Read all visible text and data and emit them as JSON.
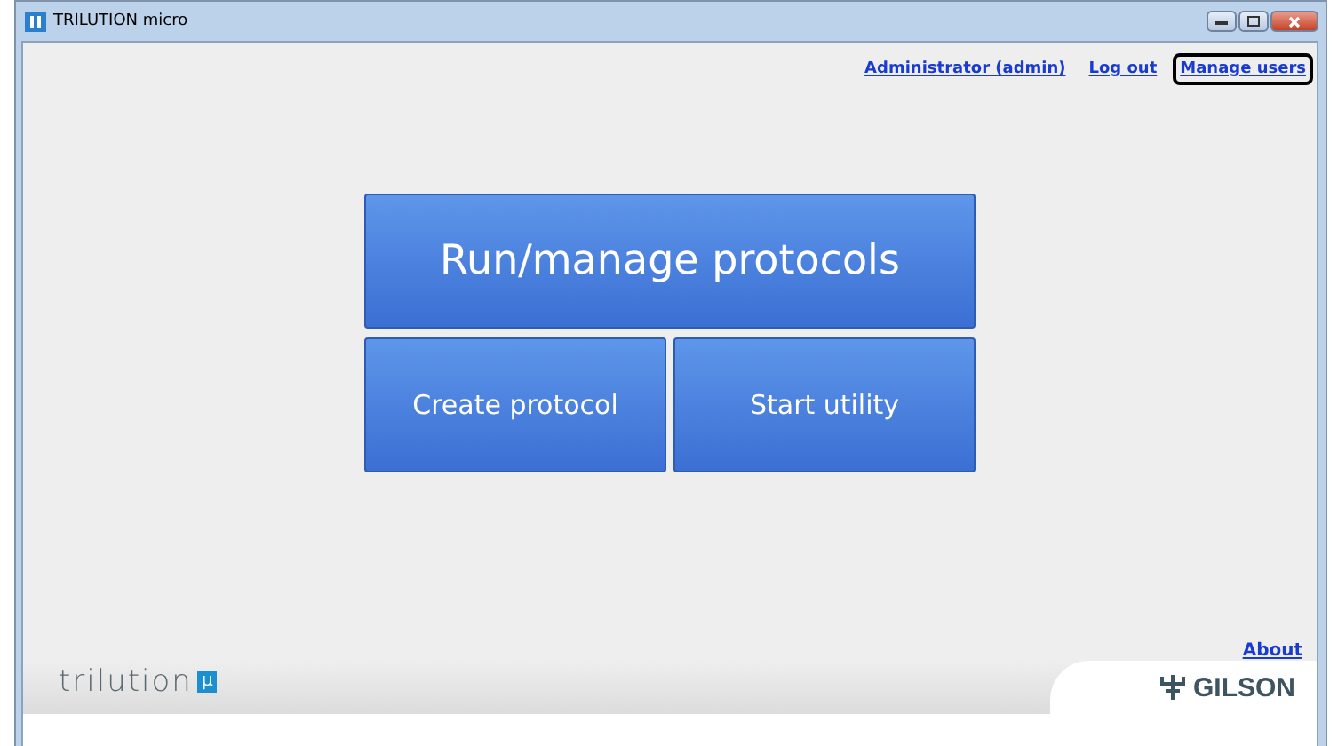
{
  "window": {
    "title": "TRILUTION micro"
  },
  "header_links": [
    {
      "label": "Administrator (admin)",
      "selected": false
    },
    {
      "label": "Log out",
      "selected": false
    },
    {
      "label": "Manage users",
      "selected": true
    }
  ],
  "main_buttons": [
    {
      "label": "Run/manage protocols",
      "kind": "large"
    },
    {
      "label": "Create protocol",
      "kind": "small"
    },
    {
      "label": "Start utility",
      "kind": "small"
    }
  ],
  "footer": {
    "about": "About",
    "product_logo": {
      "name": "trilution",
      "badge": "µ"
    },
    "brand_logo": "GILSON"
  }
}
